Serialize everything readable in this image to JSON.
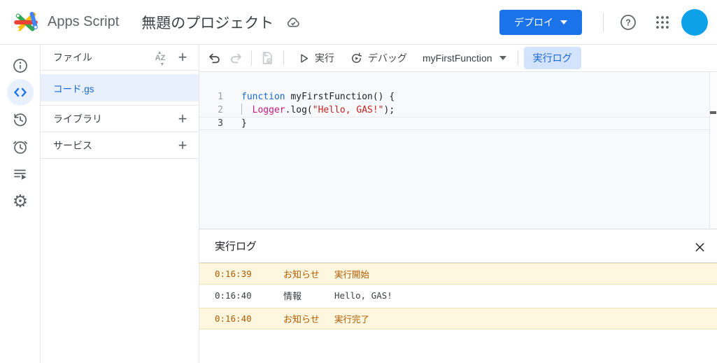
{
  "colors": {
    "accent_blue": "#1a73e8",
    "selected_item_bg": "#e8f0fe",
    "log_chip_bg": "#d3e3fd",
    "log_chip_text": "#1967d2",
    "log_notice_bg": "#fef7e0",
    "log_notice_text": "#b05a00",
    "avatar_blue": "#0da2e8",
    "code_keyword": "#1967d2",
    "code_class": "#d01884",
    "code_string": "#c5221f"
  },
  "header": {
    "app_name": "Apps Script",
    "project_title": "無題のプロジェクト",
    "deploy_button": "デプロイ",
    "icons": [
      "apps-script-logo",
      "cloud-saved-icon",
      "help-icon",
      "google-apps-grid-icon",
      "account-avatar"
    ]
  },
  "rail": {
    "items": [
      {
        "name": "overview",
        "icon": "info-icon",
        "selected": false
      },
      {
        "name": "editor",
        "icon": "code-icon",
        "selected": true
      },
      {
        "name": "project-history",
        "icon": "history-clock-icon",
        "selected": false
      },
      {
        "name": "triggers",
        "icon": "alarm-clock-icon",
        "selected": false
      },
      {
        "name": "executions",
        "icon": "list-play-icon",
        "selected": false
      },
      {
        "name": "settings",
        "icon": "gear-icon",
        "selected": false
      }
    ]
  },
  "files_panel": {
    "title": "ファイル",
    "sort_icon": "az-sort-icon",
    "add_icon": "plus-icon",
    "files": [
      {
        "name": "コード.gs",
        "selected": true
      }
    ],
    "sections": [
      {
        "label": "ライブラリ"
      },
      {
        "label": "サービス"
      }
    ]
  },
  "toolbar": {
    "undo_icon": "undo-icon",
    "redo_icon": "redo-icon",
    "save_icon": "save-project-icon",
    "run_label": "実行",
    "debug_label": "デバッグ",
    "function_selector": "myFirstFunction",
    "log_toggle": "実行ログ"
  },
  "editor": {
    "lines": [
      {
        "num": "1",
        "current": false,
        "tokens": [
          {
            "text": "function",
            "type": "keyword"
          },
          {
            "text": " myFirstFunction() {",
            "type": "plain"
          }
        ]
      },
      {
        "num": "2",
        "current": false,
        "tokens": [
          {
            "type": "indent-guide"
          },
          {
            "text": "  ",
            "type": "plain"
          },
          {
            "text": "Logger",
            "type": "class"
          },
          {
            "text": ".log(",
            "type": "plain"
          },
          {
            "text": "\"Hello, GAS!\"",
            "type": "string"
          },
          {
            "text": ");",
            "type": "plain"
          }
        ]
      },
      {
        "num": "3",
        "current": true,
        "tokens": [
          {
            "text": "}",
            "type": "plain"
          }
        ]
      }
    ]
  },
  "log_panel": {
    "title": "実行ログ",
    "close_icon": "close-icon",
    "rows": [
      {
        "time": "0:16:39",
        "type": "お知らせ",
        "message": "実行開始",
        "notice": true
      },
      {
        "time": "0:16:40",
        "type": "情報",
        "message": "Hello, GAS!",
        "notice": false
      },
      {
        "time": "0:16:40",
        "type": "お知らせ",
        "message": "実行完了",
        "notice": true
      }
    ]
  }
}
